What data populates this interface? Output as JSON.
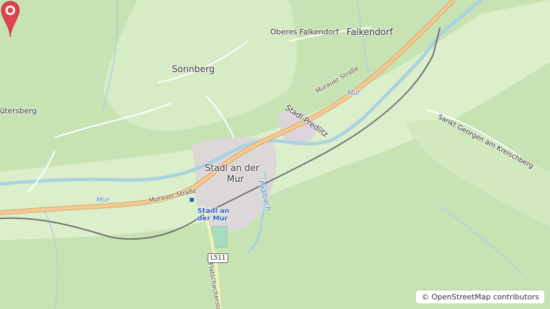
{
  "map": {
    "places": {
      "oberes_falkendorf": "Oberes Falkendorf",
      "falkendorf": "Falkendorf",
      "sonnberg": "Sonnberg",
      "gutersberg": "ütersberg",
      "stadl_line1": "Stadl an der",
      "stadl_line2": "Mur",
      "predlitz": "Stadl-Predlitz",
      "sankt_georgen": "Sankt Georgen am Kreischberg"
    },
    "roads": {
      "murauer_1": "Murauer Straße",
      "murauer_2": "Murauer Straße",
      "l511": "L511",
      "flatschach": "Flatschacherstraße"
    },
    "water": {
      "mur_east": "Mur",
      "mur_west": "Mur",
      "paalbach": "Paalbach"
    },
    "station": {
      "line1": "Stadl an",
      "line2": "der Mur"
    }
  },
  "attribution": "© OpenStreetMap contributors",
  "colors": {
    "forest": "#b8dda6",
    "meadow": "#dff0cf",
    "water": "#aad3df",
    "primary_road": "#f4c892",
    "marker": "#e0434f"
  }
}
